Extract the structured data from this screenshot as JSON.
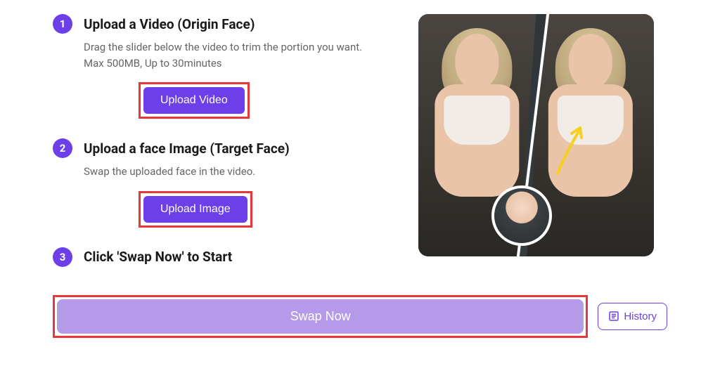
{
  "steps": [
    {
      "number": "1",
      "title": "Upload a Video (Origin Face)",
      "desc": "Drag the slider below the video to trim the portion you want. Max 500MB, Up to 30minutes",
      "button_label": "Upload Video"
    },
    {
      "number": "2",
      "title": "Upload a face Image (Target Face)",
      "desc": "Swap the uploaded face in the video.",
      "button_label": "Upload Image"
    },
    {
      "number": "3",
      "title": "Click 'Swap Now' to Start",
      "desc": "",
      "button_label": ""
    }
  ],
  "swap_button_label": "Swap Now",
  "history_button_label": "History",
  "colors": {
    "primary": "#6D3FE8",
    "swap_button": "#b49ae8",
    "highlight_border": "#e8373a"
  }
}
